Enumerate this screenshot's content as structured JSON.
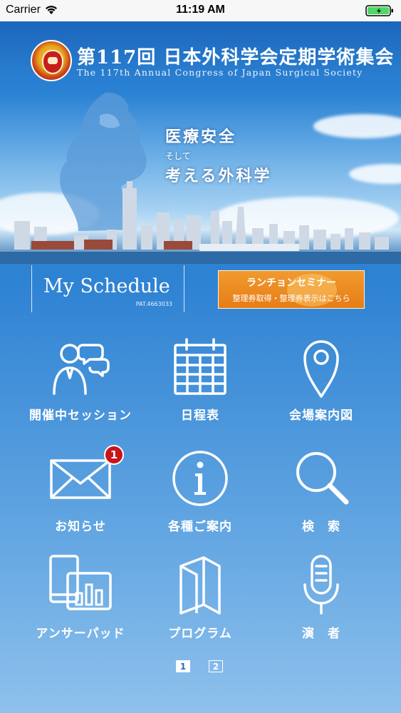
{
  "status_bar": {
    "carrier": "Carrier",
    "time": "11:19 AM"
  },
  "header": {
    "title_jp": "第117回 日本外科学会定期学術集会",
    "title_en": "The 117th Annual Congress of Japan Surgical Society"
  },
  "banner": {
    "slogan_line1": "医療安全",
    "slogan_line2": "そして",
    "slogan_line3": "考える外科学"
  },
  "schedule": {
    "label": "My Schedule",
    "patent": "PAT.4663033"
  },
  "lunch_seminar": {
    "title": "ランチョンセミナー",
    "subtitle": "整理券取得・整理券表示はこちら"
  },
  "menu": {
    "sessions": "開催中セッション",
    "schedule": "日程表",
    "venue_map": "会場案内図",
    "notices": "お知らせ",
    "notices_badge": "1",
    "guide": "各種ご案内",
    "search": "検　索",
    "answer_pad": "アンサーパッド",
    "program": "プログラム",
    "speakers": "演　者"
  },
  "pager": {
    "page1": "1",
    "page2": "2",
    "current": 1
  },
  "colors": {
    "background": "#2f83d3",
    "badge": "#c8141b",
    "lunch": "#e67d17"
  }
}
